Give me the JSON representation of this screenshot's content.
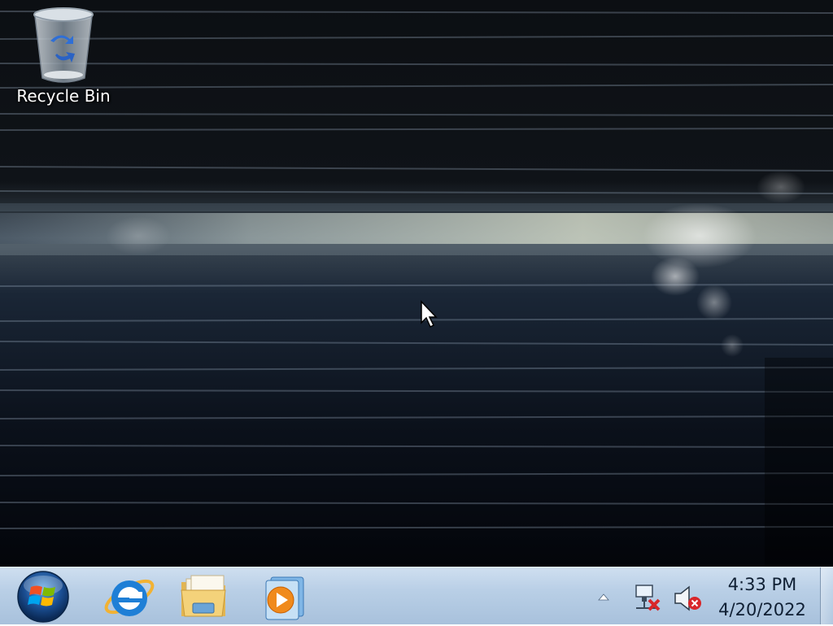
{
  "desktop": {
    "icons": [
      {
        "label": "Recycle Bin",
        "icon": "recycle-bin-icon"
      }
    ]
  },
  "taskbar": {
    "start_button": {
      "icon": "windows-logo-icon"
    },
    "pinned": [
      {
        "icon": "internet-explorer-icon"
      },
      {
        "icon": "windows-explorer-icon"
      },
      {
        "icon": "media-player-icon"
      }
    ],
    "tray": {
      "chevron_icon": "show-hidden-icons-chevron",
      "network_icon": "network-disconnected-icon",
      "volume_icon": "volume-muted-icon",
      "time": "4:33 PM",
      "date": "4/20/2022"
    }
  },
  "colors": {
    "taskbar_top": "#cfdff0",
    "taskbar_bottom": "#a8c1dc",
    "wallpaper_dark": "#05070b",
    "error_red": "#d8262a"
  }
}
